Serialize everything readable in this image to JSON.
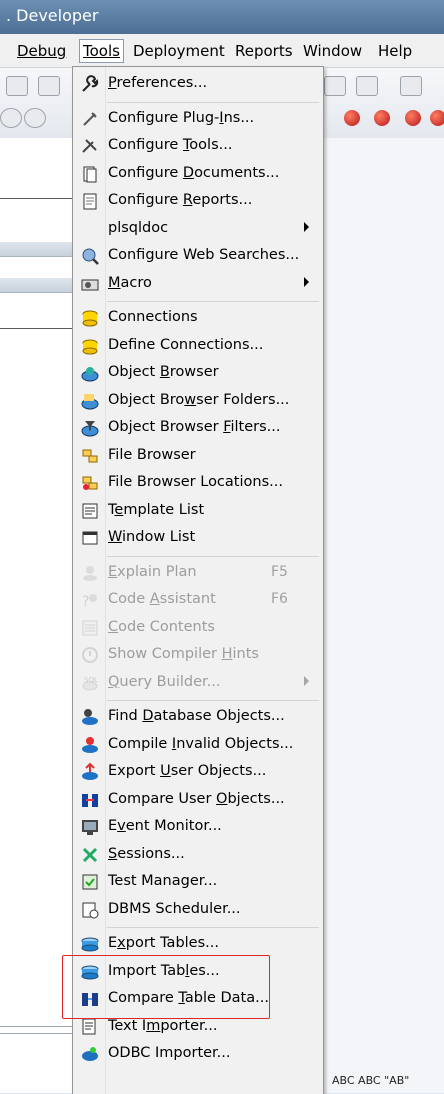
{
  "window": {
    "title": ". Developer"
  },
  "menubar": [
    "Debug",
    "Tools",
    "Deployment",
    "Reports",
    "Window",
    "Help"
  ],
  "status": {
    "text": "ABC ABC \"AB\""
  },
  "menu": [
    {
      "type": "item",
      "pre": "",
      "key": "P",
      "post": "references...",
      "icon": "wrench-icon",
      "shortcut": "",
      "submenu": false,
      "disabled": false
    },
    {
      "type": "sep"
    },
    {
      "type": "item",
      "pre": "Configure Plug-",
      "key": "I",
      "post": "ns...",
      "icon": "plug-icon",
      "shortcut": "",
      "submenu": false,
      "disabled": false
    },
    {
      "type": "item",
      "pre": "Configure ",
      "key": "T",
      "post": "ools...",
      "icon": "tools-icon",
      "shortcut": "",
      "submenu": false,
      "disabled": false
    },
    {
      "type": "item",
      "pre": "Configure ",
      "key": "D",
      "post": "ocuments...",
      "icon": "documents-icon",
      "shortcut": "",
      "submenu": false,
      "disabled": false
    },
    {
      "type": "item",
      "pre": "Configure ",
      "key": "R",
      "post": "eports...",
      "icon": "reports-icon",
      "shortcut": "",
      "submenu": false,
      "disabled": false
    },
    {
      "type": "item",
      "pre": "plsqldoc",
      "key": "",
      "post": "",
      "icon": "",
      "shortcut": "",
      "submenu": true,
      "disabled": false
    },
    {
      "type": "item",
      "pre": "Configure Web Searches...",
      "key": "",
      "post": "",
      "icon": "web-search-icon",
      "shortcut": "",
      "submenu": false,
      "disabled": false
    },
    {
      "type": "item",
      "pre": "",
      "key": "M",
      "post": "acro",
      "icon": "macro-icon",
      "shortcut": "",
      "submenu": true,
      "disabled": false
    },
    {
      "type": "sep"
    },
    {
      "type": "item",
      "pre": "Connections",
      "key": "",
      "post": "",
      "icon": "connections-icon",
      "shortcut": "",
      "submenu": false,
      "disabled": false
    },
    {
      "type": "item",
      "pre": "Define Connections...",
      "key": "",
      "post": "",
      "icon": "define-connections-icon",
      "shortcut": "",
      "submenu": false,
      "disabled": false
    },
    {
      "type": "item",
      "pre": "Object ",
      "key": "B",
      "post": "rowser",
      "icon": "object-browser-icon",
      "shortcut": "",
      "submenu": false,
      "disabled": false
    },
    {
      "type": "item",
      "pre": "Object Bro",
      "key": "w",
      "post": "ser Folders...",
      "icon": "browser-folders-icon",
      "shortcut": "",
      "submenu": false,
      "disabled": false
    },
    {
      "type": "item",
      "pre": "Object Browser ",
      "key": "F",
      "post": "ilters...",
      "icon": "browser-filters-icon",
      "shortcut": "",
      "submenu": false,
      "disabled": false
    },
    {
      "type": "item",
      "pre": "File Browser",
      "key": "",
      "post": "",
      "icon": "file-browser-icon",
      "shortcut": "",
      "submenu": false,
      "disabled": false
    },
    {
      "type": "item",
      "pre": "File Browser Locations...",
      "key": "",
      "post": "",
      "icon": "file-browser-locations-icon",
      "shortcut": "",
      "submenu": false,
      "disabled": false
    },
    {
      "type": "item",
      "pre": "T",
      "key": "e",
      "post": "mplate List",
      "icon": "template-list-icon",
      "shortcut": "",
      "submenu": false,
      "disabled": false
    },
    {
      "type": "item",
      "pre": "",
      "key": "W",
      "post": "indow List",
      "icon": "window-list-icon",
      "shortcut": "",
      "submenu": false,
      "disabled": false
    },
    {
      "type": "sep"
    },
    {
      "type": "item",
      "pre": "",
      "key": "E",
      "post": "xplain Plan",
      "icon": "explain-plan-icon",
      "shortcut": "F5",
      "submenu": false,
      "disabled": true
    },
    {
      "type": "item",
      "pre": "Code ",
      "key": "A",
      "post": "ssistant",
      "icon": "code-assistant-icon",
      "shortcut": "F6",
      "submenu": false,
      "disabled": true
    },
    {
      "type": "item",
      "pre": "",
      "key": "C",
      "post": "ode Contents",
      "icon": "code-contents-icon",
      "shortcut": "",
      "submenu": false,
      "disabled": true
    },
    {
      "type": "item",
      "pre": "Show Compiler ",
      "key": "H",
      "post": "ints",
      "icon": "compiler-hints-icon",
      "shortcut": "",
      "submenu": false,
      "disabled": true
    },
    {
      "type": "item",
      "pre": "",
      "key": "Q",
      "post": "uery Builder...",
      "icon": "query-builder-icon",
      "shortcut": "",
      "submenu": true,
      "disabled": true
    },
    {
      "type": "sep"
    },
    {
      "type": "item",
      "pre": "Find ",
      "key": "D",
      "post": "atabase Objects...",
      "icon": "find-db-objects-icon",
      "shortcut": "",
      "submenu": false,
      "disabled": false
    },
    {
      "type": "item",
      "pre": "Compile ",
      "key": "I",
      "post": "nvalid Objects...",
      "icon": "compile-invalid-icon",
      "shortcut": "",
      "submenu": false,
      "disabled": false
    },
    {
      "type": "item",
      "pre": "Export ",
      "key": "U",
      "post": "ser Objects...",
      "icon": "export-user-objects-icon",
      "shortcut": "",
      "submenu": false,
      "disabled": false
    },
    {
      "type": "item",
      "pre": "Compare User ",
      "key": "O",
      "post": "bjects...",
      "icon": "compare-user-objects-icon",
      "shortcut": "",
      "submenu": false,
      "disabled": false
    },
    {
      "type": "item",
      "pre": "E",
      "key": "v",
      "post": "ent Monitor...",
      "icon": "event-monitor-icon",
      "shortcut": "",
      "submenu": false,
      "disabled": false
    },
    {
      "type": "item",
      "pre": "",
      "key": "S",
      "post": "essions...",
      "icon": "sessions-icon",
      "shortcut": "",
      "submenu": false,
      "disabled": false
    },
    {
      "type": "item",
      "pre": "Test Manager...",
      "key": "",
      "post": "",
      "icon": "test-manager-icon",
      "shortcut": "",
      "submenu": false,
      "disabled": false
    },
    {
      "type": "item",
      "pre": "DBMS Scheduler...",
      "key": "",
      "post": "",
      "icon": "dbms-scheduler-icon",
      "shortcut": "",
      "submenu": false,
      "disabled": false
    },
    {
      "type": "sep"
    },
    {
      "type": "item",
      "pre": "E",
      "key": "x",
      "post": "port Tables...",
      "icon": "export-tables-icon",
      "shortcut": "",
      "submenu": false,
      "disabled": false
    },
    {
      "type": "item",
      "pre": "Import Tab",
      "key": "l",
      "post": "es...",
      "icon": "import-tables-icon",
      "shortcut": "",
      "submenu": false,
      "disabled": false
    },
    {
      "type": "item",
      "pre": "Compare ",
      "key": "T",
      "post": "able Data...",
      "icon": "compare-table-data-icon",
      "shortcut": "",
      "submenu": false,
      "disabled": false
    },
    {
      "type": "item",
      "pre": "Text I",
      "key": "m",
      "post": "porter...",
      "icon": "text-importer-icon",
      "shortcut": "",
      "submenu": false,
      "disabled": false
    },
    {
      "type": "item",
      "pre": "ODBC Importer...",
      "key": "",
      "post": "",
      "icon": "odbc-importer-icon",
      "shortcut": "",
      "submenu": false,
      "disabled": false
    }
  ]
}
